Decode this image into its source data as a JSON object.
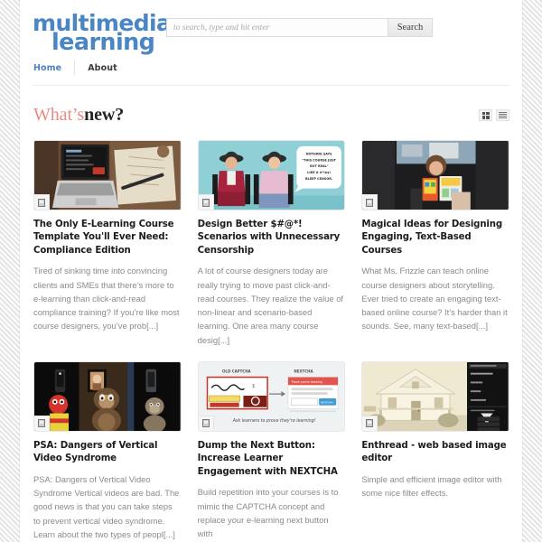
{
  "site": {
    "logo_line1": "multimedia",
    "logo_line2": "learning",
    "logo_color": "#4a86c5"
  },
  "search": {
    "placeholder": "to search, type and hit enter",
    "value": "",
    "button_label": "Search"
  },
  "nav": {
    "items": [
      {
        "label": "Home",
        "active": true
      },
      {
        "label": "About",
        "active": false
      }
    ]
  },
  "section": {
    "title_accent": "What’s",
    "title_strong": "new?",
    "accent_color": "#e98a86",
    "view_grid_label": "Grid view",
    "view_list_label": "List view"
  },
  "posts": [
    {
      "title": "The Only E-Learning Course Template You'll Ever Need: Compliance Edition",
      "excerpt": "Tired of sinking time into convincing clients and SMEs that there’s more to e-learning than click-and-read compliance training? If you’re like most course designers, you’ve prob[...]",
      "thumb": "laptop-desk",
      "format_icon": "post-format-icon"
    },
    {
      "title": "Design Better $#@*! Scenarios with Unnecessary Censorship",
      "excerpt": "A lot of course designers today are really trying to move past click-and-read courses. They realize the value of non-linear and scenario-based learning. One area many course desig[...]",
      "thumb": "two-women-speech-bubble",
      "bubble_text": "NOTHING SAYS “THIS COURSE JUST GOT REAL” LIKE A #*!$$! BLEEP CENSOR.",
      "format_icon": "post-format-icon"
    },
    {
      "title": "Magical Ideas for Designing Engaging, Text-Based Courses",
      "excerpt": "What Ms. Frizzle can teach online course designers about storytelling. Ever tried to create an engaging text-based online course? It’s harder than it sounds. See, many text-based[...]",
      "thumb": "child-reading-books",
      "format_icon": "post-format-icon"
    },
    {
      "title": "PSA: Dangers of Vertical Video Syndrome",
      "excerpt": "PSA: Dangers of Vertical Video Syndrome Vertical videos are bad. The good news is that you can take steps to prevent vertical video syndrome. Learn about the two types of peopl[...]",
      "thumb": "puppets-stage",
      "format_icon": "post-format-icon"
    },
    {
      "title": "Dump the Next Button: Increase Learner Engagement with NEXTCHA",
      "excerpt": "Build repetition into your courses is to mimic the CAPTCHA concept and replace your e-learning next button with",
      "thumb": "captcha-diagram",
      "diagram_left_label": "OLD CAPTCHA",
      "diagram_right_label": "NEXTCHA",
      "diagram_caption": "Ask learners to prove they're learning!",
      "format_icon": "post-format-icon"
    },
    {
      "title": "Enthread - web based image editor",
      "excerpt": "Simple and efficient image editor with some nice filter effects.",
      "thumb": "house-image-editor",
      "format_icon": "post-format-icon"
    }
  ]
}
